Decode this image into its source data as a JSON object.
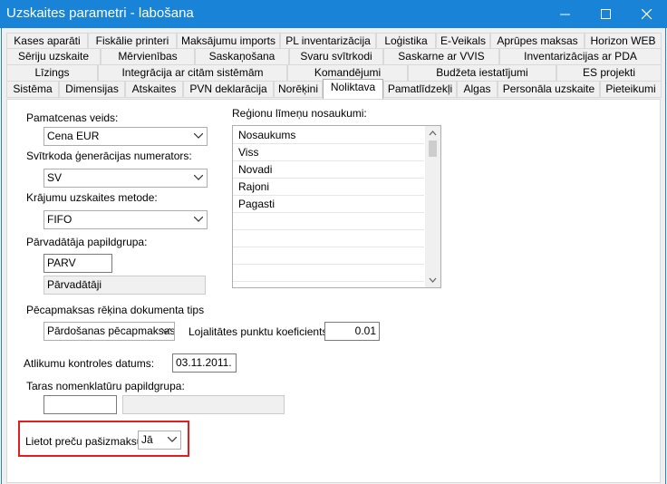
{
  "window": {
    "title": "Uzskaites parametri - labošana"
  },
  "tabs": {
    "row1": [
      "Kases aparāti",
      "Fiskālie printeri",
      "Maksājumu imports",
      "PL inventarizācija",
      "Loģistika",
      "E-Veikals",
      "Aprūpes maksas",
      "Horizon WEB"
    ],
    "row2": [
      "Sēriju uzskaite",
      "Mērvienības",
      "Saskaņošana",
      "Svaru svītrkodi",
      "Saskarne ar VVIS",
      "Inventarizācijas ar PDA"
    ],
    "row3": [
      "Līzings",
      "Integrācija ar citām sistēmām",
      "Komandējumi",
      "Budžeta iestatījumi",
      "ES projekti"
    ],
    "row4": [
      "Sistēma",
      "Dimensijas",
      "Atskaites",
      "PVN deklarācija",
      "Norēķini",
      "Noliktava",
      "Pamatlīdzekļi",
      "Algas",
      "Personāla uzskaite",
      "Pieteikumi"
    ],
    "active": "Noliktava"
  },
  "form": {
    "pamatcenas_label": "Pamatcenas veids:",
    "pamatcenas_value": "Cena EUR",
    "svitrkoda_label": "Svītrkoda ģenerācijas numerators:",
    "svitrkoda_value": "SV",
    "krajumu_label": "Krājumu uzskaites metode:",
    "krajumu_value": "FIFO",
    "parvadataja_label": "Pārvadātāja papildgrupa:",
    "parvadataja_code": "PARV",
    "parvadataja_name": "Pārvadātāji",
    "pecapmaksas_label": "Pēcapmaksas rēķina dokumenta tips",
    "pecapmaksas_value": "Pārdošanas pēcapmaksas",
    "lojalitates_label": "Lojalitātes punktu koeficients:",
    "lojalitates_value": "0.01",
    "atlikumu_label": "Atlikumu kontroles datums:",
    "atlikumu_value": "03.11.2011.",
    "taras_label": "Taras nomenklatūru papildgrupa:",
    "taras_code": "",
    "taras_name": "",
    "lietot_label": "Lietot preču pašizmaksu:",
    "lietot_value": "Jā"
  },
  "regions": {
    "label": "Reģionu līmeņu nosaukumi:",
    "items": [
      "Nosaukums",
      "Viss",
      "Novadi",
      "Rajoni",
      "Pagasti"
    ]
  },
  "colors": {
    "titlebar": "#1883d7",
    "highlight": "#e02020"
  }
}
